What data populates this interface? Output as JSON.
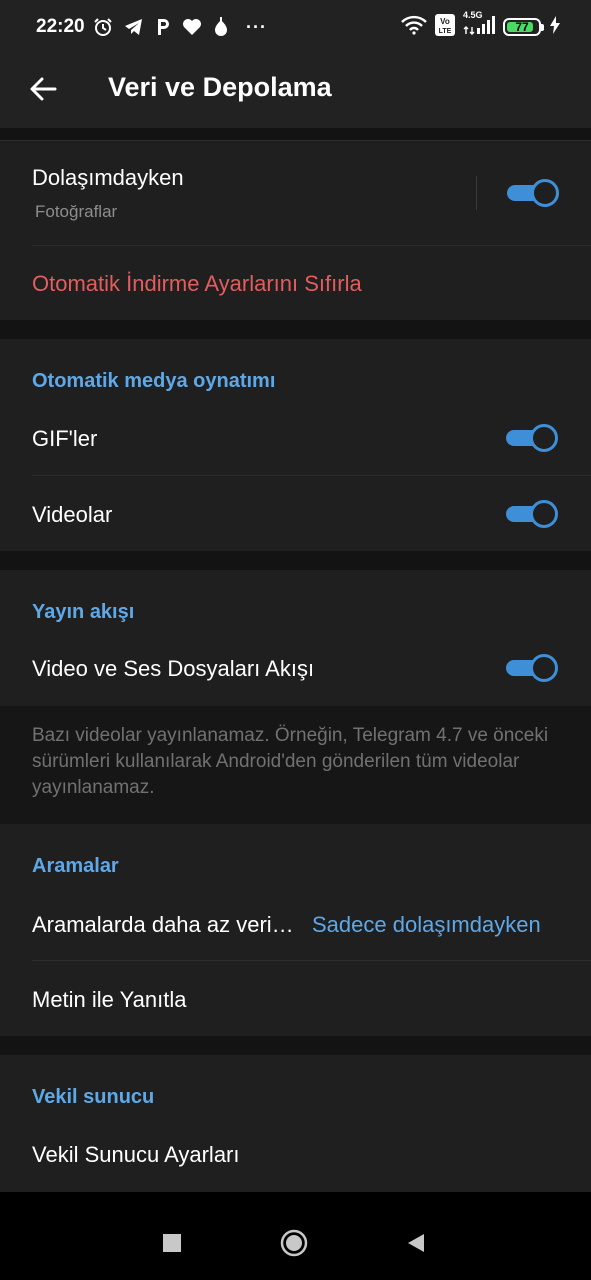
{
  "status_bar": {
    "time": "22:20",
    "battery": "77",
    "battery_level": 0.77,
    "network_label": "4.5G",
    "volte_label": "Vo LTE",
    "icons": [
      "alarm-icon",
      "telegram-icon",
      "p-icon",
      "heart-icon",
      "drop-icon",
      "more-dots-icon",
      "wifi-icon",
      "volte-icon",
      "signal-icon",
      "battery-icon",
      "charging-icon"
    ]
  },
  "app_bar": {
    "title": "Veri ve Depolama",
    "back_icon": "arrow-left-icon"
  },
  "auto_download": {
    "roaming": {
      "title": "Dolaşımdayken",
      "subtitle": "Fotoğraflar",
      "enabled": true
    },
    "reset_label": "Otomatik İndirme Ayarlarını Sıfırla"
  },
  "autoplay": {
    "header": "Otomatik medya oynatımı",
    "items": [
      {
        "label": "GIF'ler",
        "enabled": true
      },
      {
        "label": "Videolar",
        "enabled": true
      }
    ]
  },
  "streaming": {
    "header": "Yayın akışı",
    "item": {
      "label": "Video ve Ses Dosyaları Akışı",
      "enabled": true
    },
    "info": "Bazı videolar yayınlanamaz. Örneğin, Telegram 4.7 ve önceki sürümleri kullanılarak Android'den gönderilen tüm videolar yayınlanamaz."
  },
  "calls": {
    "header": "Aramalar",
    "less_data": {
      "label": "Aramalarda daha az veri…",
      "value": "Sadece dolaşımdayken"
    },
    "reply_text": "Metin ile Yanıtla"
  },
  "proxy": {
    "header": "Vekil sunucu",
    "settings": "Vekil Sunucu Ayarları"
  },
  "colors": {
    "accent": "#5fa8e8",
    "toggle_on": "#3e8fd8",
    "danger": "#e35d5d",
    "surface": "#1f1f1f",
    "background": "#131313"
  },
  "nav_bar": {
    "icons": [
      "recents-square-icon",
      "home-circle-icon",
      "back-triangle-icon"
    ]
  }
}
